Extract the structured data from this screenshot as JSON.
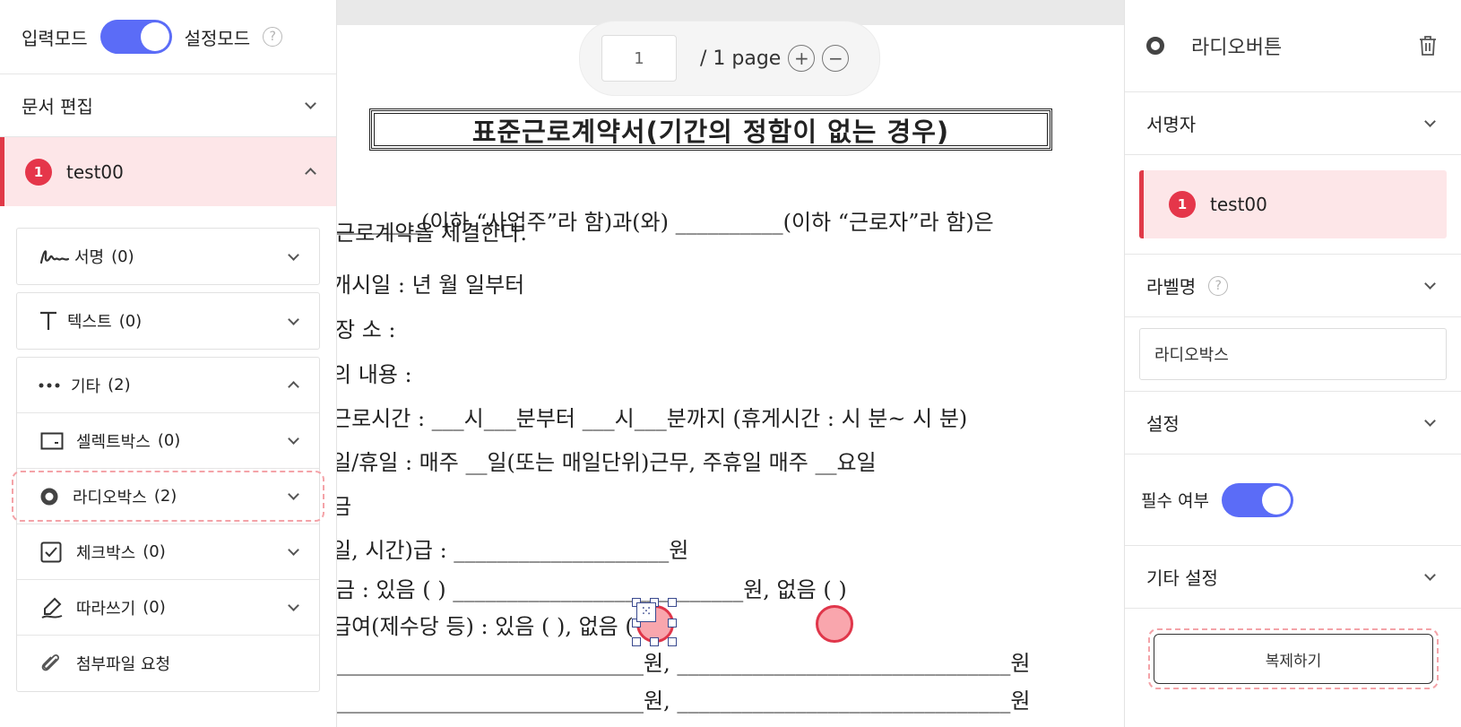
{
  "mode_bar": {
    "input_mode": "입력모드",
    "settings_mode": "설정모드",
    "help": "?"
  },
  "left_sections": {
    "doc_edit": "문서 편집"
  },
  "signer": {
    "number": "1",
    "name": "test00"
  },
  "tools": {
    "signature": {
      "label": "서명",
      "count": "(0)"
    },
    "text": {
      "label": "텍스트",
      "count": "(0)"
    },
    "etc": {
      "label": "기타",
      "count": "(2)"
    },
    "selectbox": {
      "label": "셀렉트박스",
      "count": "(0)"
    },
    "radiobox": {
      "label": "라디오박스",
      "count": "(2)"
    },
    "checkbox": {
      "label": "체크박스",
      "count": "(0)"
    },
    "tracing": {
      "label": "따라쓰기",
      "count": "(0)"
    },
    "attachment": {
      "label": "첨부파일 요청"
    }
  },
  "pager": {
    "current_page": "1",
    "total": "/ 1 page",
    "zoom_in": "+",
    "zoom_out": "−"
  },
  "document": {
    "title": "표준근로계약서(기간의 정함이 없는 경우)",
    "lines": [
      "________(이하 “사업주”라 함)과(와) __________(이하 “근로자”라 함)은",
      " 근로계약을 체결한다.",
      "개시일 :        년     월     일부터",
      " 장  소 :",
      "의 내용 :",
      "근로시간 : ___시___분부터 ___시___분까지 (휴게시간 :  시   분~   시    분)",
      "일/휴일 : 매주 __일(또는 매일단위)근무, 주휴일 매주 __요일",
      "금",
      "일, 시간)급 : ____________________원",
      " 금 : 있음 (       ) ___________________________원,  없음 (        )",
      "급여(제수당 등) : 있음 (         ),     없음 (         )",
      "_____________________________원,   _______________________________원",
      "_____________________________원,   _______________________________원"
    ]
  },
  "right": {
    "header_title": "라디오버튼",
    "signer_section": "서명자",
    "signer_name": "test00",
    "signer_number": "1",
    "label_name": "라벨명",
    "label_value": "라디오박스",
    "settings": "설정",
    "required": "필수 여부",
    "other_settings": "기타 설정",
    "duplicate": "복제하기"
  },
  "colors": {
    "accent": "#5b6cf7",
    "signer_red": "#e5364a",
    "signer_bg": "#fde6e8",
    "radio_fill": "#f9a6ad"
  }
}
